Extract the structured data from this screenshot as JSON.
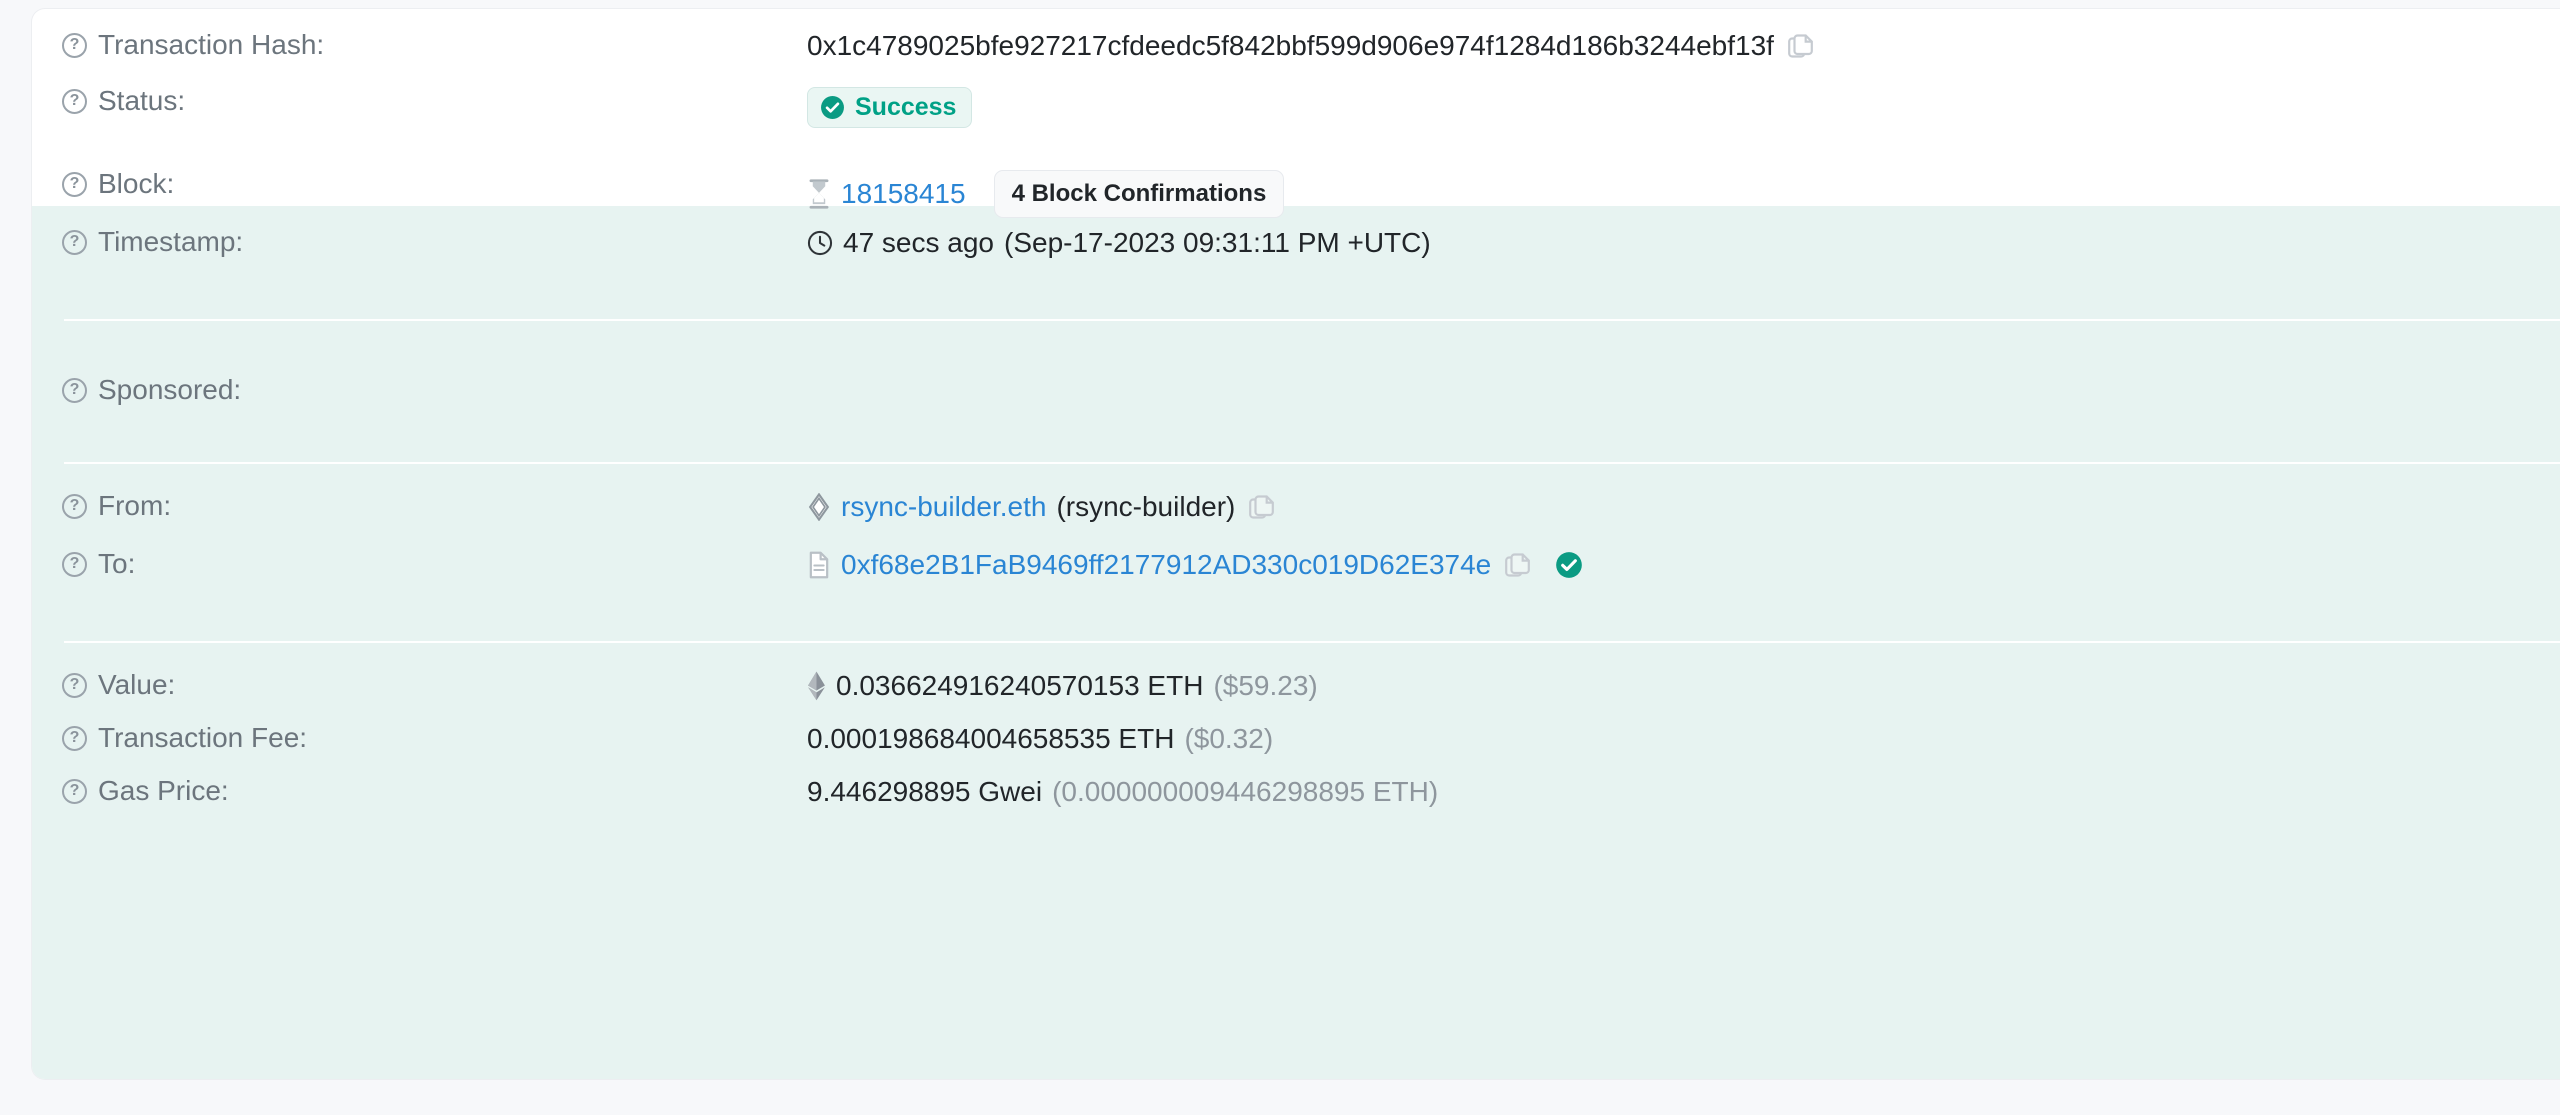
{
  "card": {
    "accent_link": "#2a85d4",
    "success_color": "#00a186",
    "tint_background": "#e7f3f1"
  },
  "rows": {
    "transaction_hash": {
      "label": "Transaction Hash:",
      "value": "0x1c4789025bfe927217cfdeedc5f842bbf599d906e974f1284d186b3244ebf13f",
      "copy_icon": "copy-icon",
      "help_icon": "help-circle-icon"
    },
    "status": {
      "label": "Status:",
      "badge_text": "Success",
      "badge_icon": "check-circle-icon",
      "help_icon": "help-circle-icon"
    },
    "block": {
      "label": "Block:",
      "icon": "hourglass-icon",
      "number": "18158415",
      "confirmations": "4 Block Confirmations",
      "help_icon": "help-circle-icon"
    },
    "timestamp": {
      "label": "Timestamp:",
      "icon": "clock-icon",
      "relative": "47 secs ago",
      "absolute": "(Sep-17-2023 09:31:11 PM +UTC)",
      "help_icon": "help-circle-icon"
    },
    "sponsored": {
      "label": "Sponsored:",
      "value": "",
      "help_icon": "help-circle-icon"
    },
    "from": {
      "label": "From:",
      "icon": "ens-diamond-icon",
      "name": "rsync-builder.eth",
      "alias": "(rsync-builder)",
      "copy_icon": "copy-icon",
      "help_icon": "help-circle-icon"
    },
    "to": {
      "label": "To:",
      "icon": "contract-document-icon",
      "address": "0xf68e2B1FaB9469ff2177912AD330c019D62E374e",
      "copy_icon": "copy-icon",
      "verified_icon": "verified-check-icon",
      "help_icon": "help-circle-icon"
    },
    "value": {
      "label": "Value:",
      "icon": "ethereum-diamond-icon",
      "amount": "0.036624916240570153 ETH",
      "fiat": "($59.23)",
      "help_icon": "help-circle-icon"
    },
    "transaction_fee": {
      "label": "Transaction Fee:",
      "amount": "0.000198684004658535 ETH",
      "fiat": "($0.32)",
      "help_icon": "help-circle-icon"
    },
    "gas_price": {
      "label": "Gas Price:",
      "amount": "9.446298895 Gwei",
      "eth": "(0.000000009446298895 ETH)",
      "help_icon": "help-circle-icon"
    }
  }
}
